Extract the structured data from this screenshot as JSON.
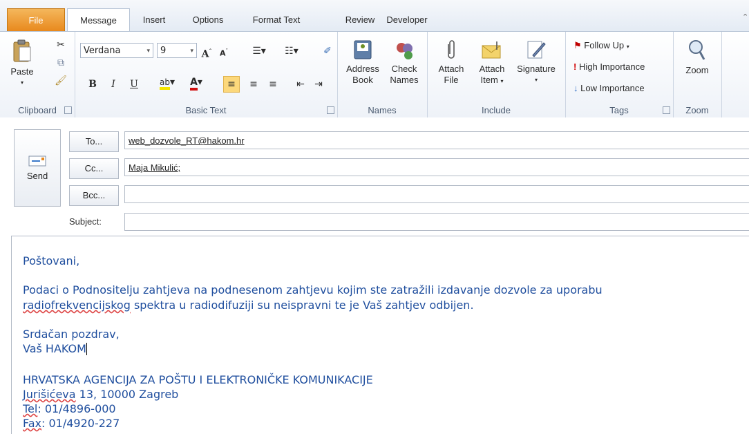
{
  "tabs": [
    {
      "label": "File"
    },
    {
      "label": "Message"
    },
    {
      "label": "Insert"
    },
    {
      "label": "Options"
    },
    {
      "label": "Format Text"
    },
    {
      "label": "Review"
    },
    {
      "label": "Developer"
    }
  ],
  "ribbon": {
    "clipboard": {
      "label": "Clipboard",
      "paste": "Paste"
    },
    "basic_text": {
      "label": "Basic Text",
      "font": "Verdana",
      "size": "9"
    },
    "names": {
      "label": "Names",
      "address_book_1": "Address",
      "address_book_2": "Book",
      "check_names_1": "Check",
      "check_names_2": "Names"
    },
    "include": {
      "label": "Include",
      "attach_file_1": "Attach",
      "attach_file_2": "File",
      "attach_item_1": "Attach",
      "attach_item_2": "Item",
      "signature": "Signature"
    },
    "tags": {
      "label": "Tags",
      "follow_up": "Follow Up",
      "high": "High Importance",
      "low": "Low Importance"
    },
    "zoom": {
      "label": "Zoom",
      "button": "Zoom"
    }
  },
  "header": {
    "send": "Send",
    "to_button": "To...",
    "cc_button": "Cc...",
    "bcc_button": "Bcc...",
    "subject_label": "Subject:",
    "to_value": "web_dozvole_RT@hakom.hr",
    "cc_value": "Maja Mikulić;",
    "bcc_value": "",
    "subject_value": ""
  },
  "body": {
    "greeting": "Poštovani,",
    "line1": "Podaci o Podnositelju zahtjeva na podnesenom zahtjevu kojim ste zatražili izdavanje dozvole za uporabu",
    "line2_word": "radiofrekvencijskog",
    "line2_rest": " spektra u radiodifuziji su neispravni te je Vaš zahtjev odbijen.",
    "closing": "Srdačan pozdrav,",
    "sign": "Vaš HAKOM",
    "org": "HRVATSKA AGENCIJA ZA POŠTU I ELEKTRONIČKE KOMUNIKACIJE",
    "addr_word": "Jurišićeva",
    "addr_rest": " 13, 10000 Zagreb",
    "tel_word": "Tel",
    "tel_rest": ": 01/4896-000",
    "fax_word": "Fax",
    "fax_rest": ": 01/4920-227"
  },
  "colors": {
    "accent": "#e8891d",
    "body_text": "#1f4e9e",
    "active_align": "#fcd87b"
  }
}
